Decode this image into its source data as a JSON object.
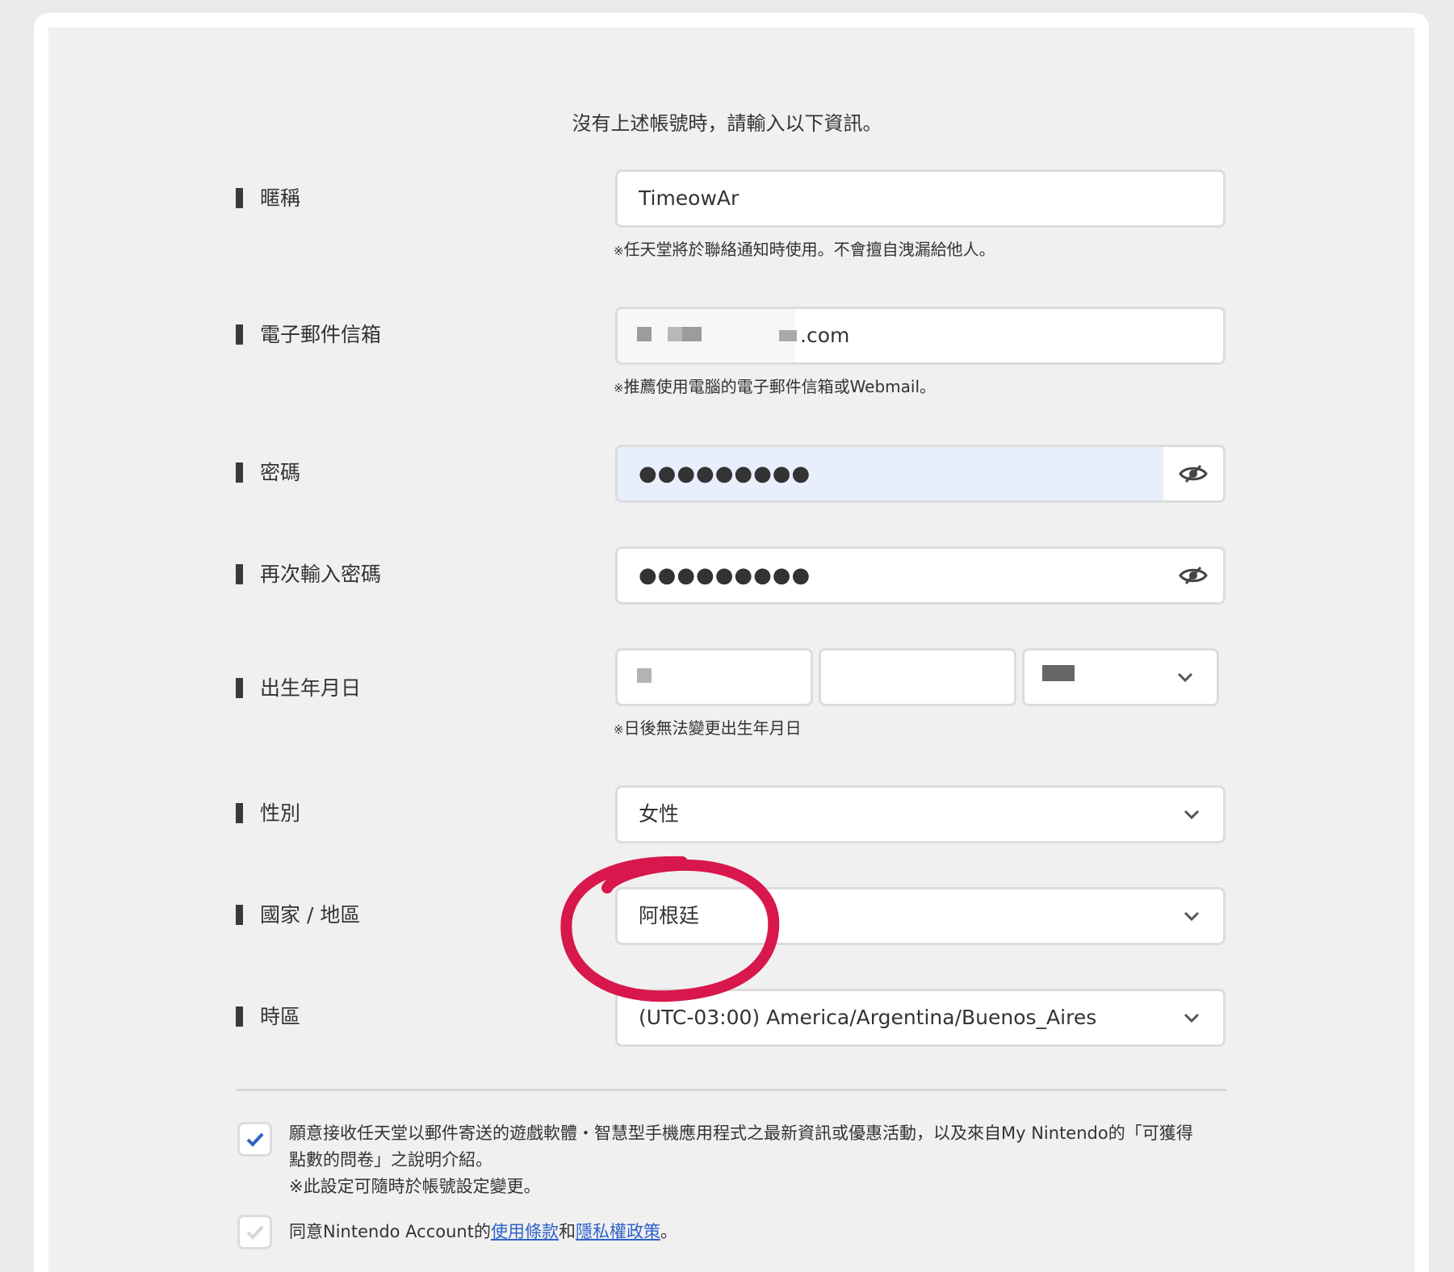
{
  "intro": "沒有上述帳號時，請輸入以下資訊。",
  "fields": {
    "nickname": {
      "label": "暱稱",
      "value": "TimeowAr",
      "note": "任天堂將於聯絡通知時使用。不會擅自洩漏給他人。"
    },
    "email": {
      "label": "電子郵件信箱",
      "value_suffix": ".com",
      "note": "推薦使用電腦的電子郵件信箱或Webmail。"
    },
    "password": {
      "label": "密碼",
      "value": "●●●●●●●●●"
    },
    "password_confirm": {
      "label": "再次輸入密碼",
      "value": "●●●●●●●●●"
    },
    "birthday": {
      "label": "出生年月日",
      "note": "日後無法變更出生年月日"
    },
    "gender": {
      "label": "性別",
      "value": "女性"
    },
    "country": {
      "label": "國家 / 地區",
      "value": "阿根廷"
    },
    "timezone": {
      "label": "時區",
      "value": "(UTC-03:00) America/Argentina/Buenos_Aires"
    }
  },
  "note_mark": "※",
  "consent": {
    "newsletter_line1": "願意接收任天堂以郵件寄送的遊戲軟體・智慧型手機應用程式之最新資訊或優惠活動，以及來自My Nintendo的「可獲得",
    "newsletter_line2": "點數的問卷」之說明介紹。",
    "newsletter_line3": "※此設定可隨時於帳號設定變更。",
    "newsletter_checked": true,
    "terms_prefix": "同意Nintendo Account的",
    "terms_link": "使用條款",
    "terms_and": "和",
    "privacy_link": "隱私權政策",
    "terms_suffix": "。",
    "terms_checked": false
  },
  "colors": {
    "accent": "#2e62c9",
    "highlight_circle": "#d8174c",
    "filled_input": "#e8eefb"
  }
}
